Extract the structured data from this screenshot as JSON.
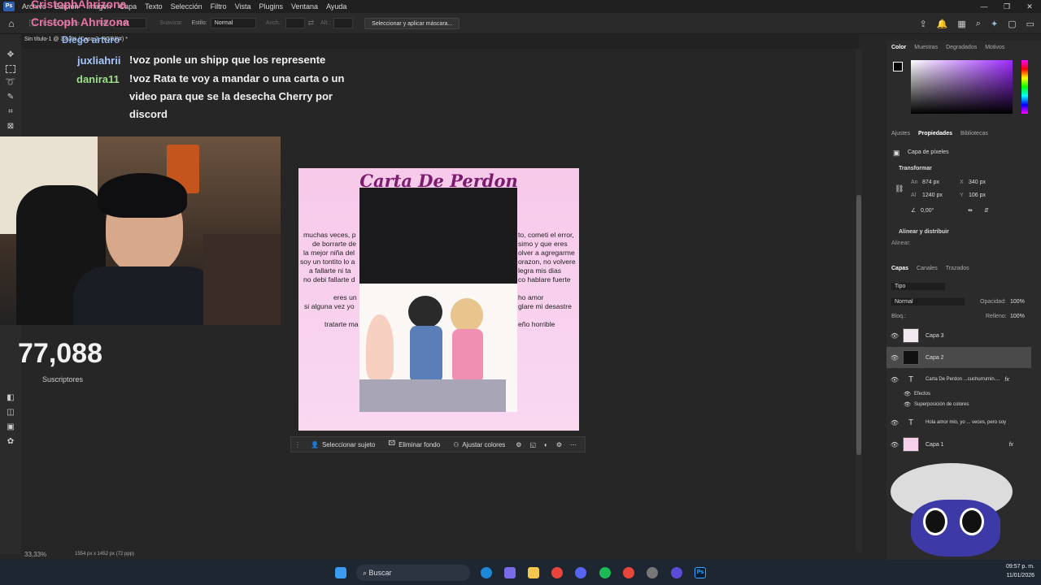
{
  "menubar": {
    "logo": "Ps",
    "items": [
      "Archivo",
      "Edición",
      "Imagen",
      "Capa",
      "Texto",
      "Selección",
      "Filtro",
      "Vista",
      "Plugins",
      "Ventana",
      "Ayuda"
    ],
    "window_controls": [
      "—",
      "❐",
      "✕"
    ]
  },
  "options_bar": {
    "calado_label": "Cal.:",
    "calado_value": "0 px",
    "suavizar": "Suavizar",
    "estilo_label": "Estilo:",
    "estilo_value": "Normal",
    "ancho_label": "Anch.:",
    "alto_label": "Alt.:",
    "mask_button": "Seleccionar y aplicar máscara..."
  },
  "document_tab": {
    "label": "Sin título-1 @ 33,3% (Capa 2, RGB/8#) *"
  },
  "stream": {
    "overlay_names": [
      "CristophAhrizona",
      "Cristoph Ahrizona",
      "Diego arturo"
    ],
    "chat": [
      {
        "user": "juxliahrii",
        "color": "#a7c7ff",
        "message": "!voz ponle un shipp que los represente"
      },
      {
        "user": "danira11",
        "color": "#9be08a",
        "message": "!voz Rata te voy a mandar o una carta o un video para que se la desecha Cherry por discord"
      }
    ],
    "subscriber_count": "77,088",
    "subscriber_label": "Suscriptores"
  },
  "document": {
    "title": "Carta De Perdon",
    "left_lines": [
      "muchas veces, p",
      "de borrarte de",
      "la mejor niña del",
      "soy un tontito lo a",
      "a fallarte ni ta",
      "no debi fallarte d",
      "eres un",
      "si alguna vez yo",
      "tratarte ma"
    ],
    "right_lines": [
      "to, cometi el error,",
      "simo y que eres",
      "olver a agregarme",
      "orazon, no volvere",
      "legra mis dias",
      "co hablare fuerte",
      "ho amor",
      "glare mi desastre",
      "eño horrible"
    ]
  },
  "context_bar": {
    "select_subject": "Seleccionar sujeto",
    "remove_bg": "Eliminar fondo",
    "adjust_colors": "Ajustar colores"
  },
  "status_bar": {
    "zoom": "33,33%",
    "doc_size": "1554 px x 1452 px (72 ppp)"
  },
  "color_panel": {
    "tabs": [
      "Color",
      "Muestras",
      "Degradados",
      "Motivos"
    ]
  },
  "properties_panel": {
    "tabs": [
      "Ajustes",
      "Propiedades",
      "Bibliotecas"
    ],
    "layer_type": "Capa de píxeles",
    "transform_label": "Transformar",
    "width": "874 px",
    "x": "340 px",
    "height": "1240 px",
    "y": "106 px",
    "angle": "0,00°",
    "align_label": "Alinear y distribuir",
    "align_sub": "Alinear:"
  },
  "layers_panel": {
    "tabs": [
      "Capas",
      "Canales",
      "Trazados"
    ],
    "filter": "Tipo",
    "blend_mode": "Normal",
    "opacity_label": "Opacidad:",
    "opacity": "100%",
    "lock_label": "Bloq.:",
    "fill_label": "Relleno:",
    "fill": "100%",
    "layers": [
      {
        "name": "Capa 3",
        "type": "pixel"
      },
      {
        "name": "Capa 2",
        "type": "pixel",
        "selected": true
      },
      {
        "name": "Carta De Perdon ...cuchurrumin....",
        "type": "text",
        "fx": "fx"
      },
      {
        "name": "Efectos",
        "type": "effect"
      },
      {
        "name": "Superposición de colores",
        "type": "effect"
      },
      {
        "name": "Hola amor mio, yo ... veces, pero  soy",
        "type": "text"
      },
      {
        "name": "Capa 1",
        "type": "pixel",
        "fx": "fx"
      }
    ]
  },
  "taskbar": {
    "search": "Buscar",
    "time": "09:57 p. m.",
    "date": "11/01/2026"
  }
}
